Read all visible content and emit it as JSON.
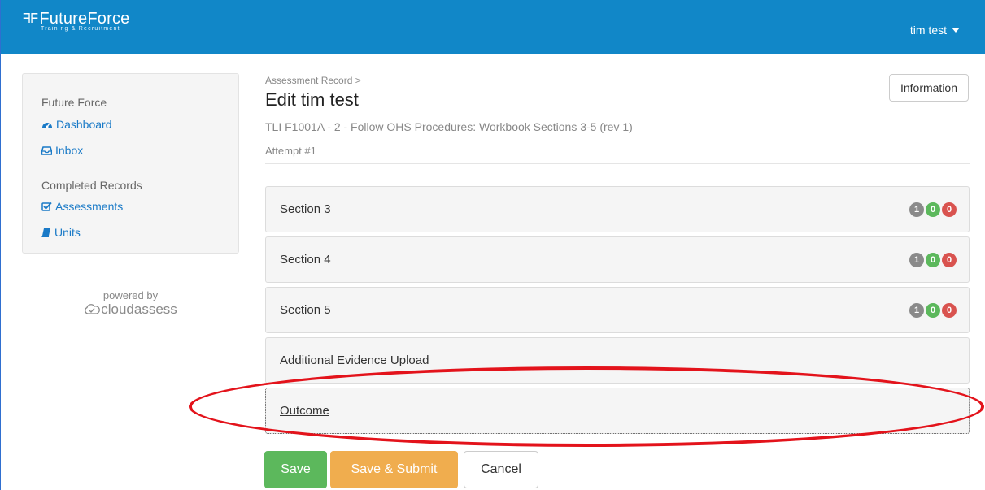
{
  "header": {
    "brand_name": "FutureForce",
    "brand_tagline": "Training & Recruitment",
    "user_name": "tim test"
  },
  "sidebar": {
    "org_heading": "Future Force",
    "nav_items": [
      {
        "label": "Dashboard",
        "icon": "dashboard-icon"
      },
      {
        "label": "Inbox",
        "icon": "inbox-icon"
      }
    ],
    "completed_heading": "Completed Records",
    "completed_items": [
      {
        "label": "Assessments",
        "icon": "checkbox-icon"
      },
      {
        "label": "Units",
        "icon": "book-icon"
      }
    ]
  },
  "powered_by": {
    "label": "powered by",
    "logo_text": "cloudassess"
  },
  "main": {
    "breadcrumb": "Assessment Record >",
    "title": "Edit tim test",
    "subtitle": "TLI F1001A - 2 - Follow OHS Procedures: Workbook Sections 3-5 (rev 1)",
    "attempt": "Attempt #1",
    "info_button": "Information",
    "sections": [
      {
        "title": "Section 3",
        "badges": [
          "1",
          "0",
          "0"
        ]
      },
      {
        "title": "Section 4",
        "badges": [
          "1",
          "0",
          "0"
        ]
      },
      {
        "title": "Section 5",
        "badges": [
          "1",
          "0",
          "0"
        ]
      },
      {
        "title": "Additional Evidence Upload"
      },
      {
        "title": "Outcome"
      }
    ],
    "buttons": {
      "save": "Save",
      "save_submit": "Save & Submit",
      "cancel": "Cancel"
    }
  },
  "colors": {
    "navbar": "#1187c8",
    "link": "#1a7ac7",
    "badge_gray": "#8a8a8a",
    "badge_green": "#5cb85c",
    "badge_red": "#d9534f",
    "save": "#5cb85c",
    "save_submit": "#f0ad4e",
    "annotation": "#e3131b"
  }
}
